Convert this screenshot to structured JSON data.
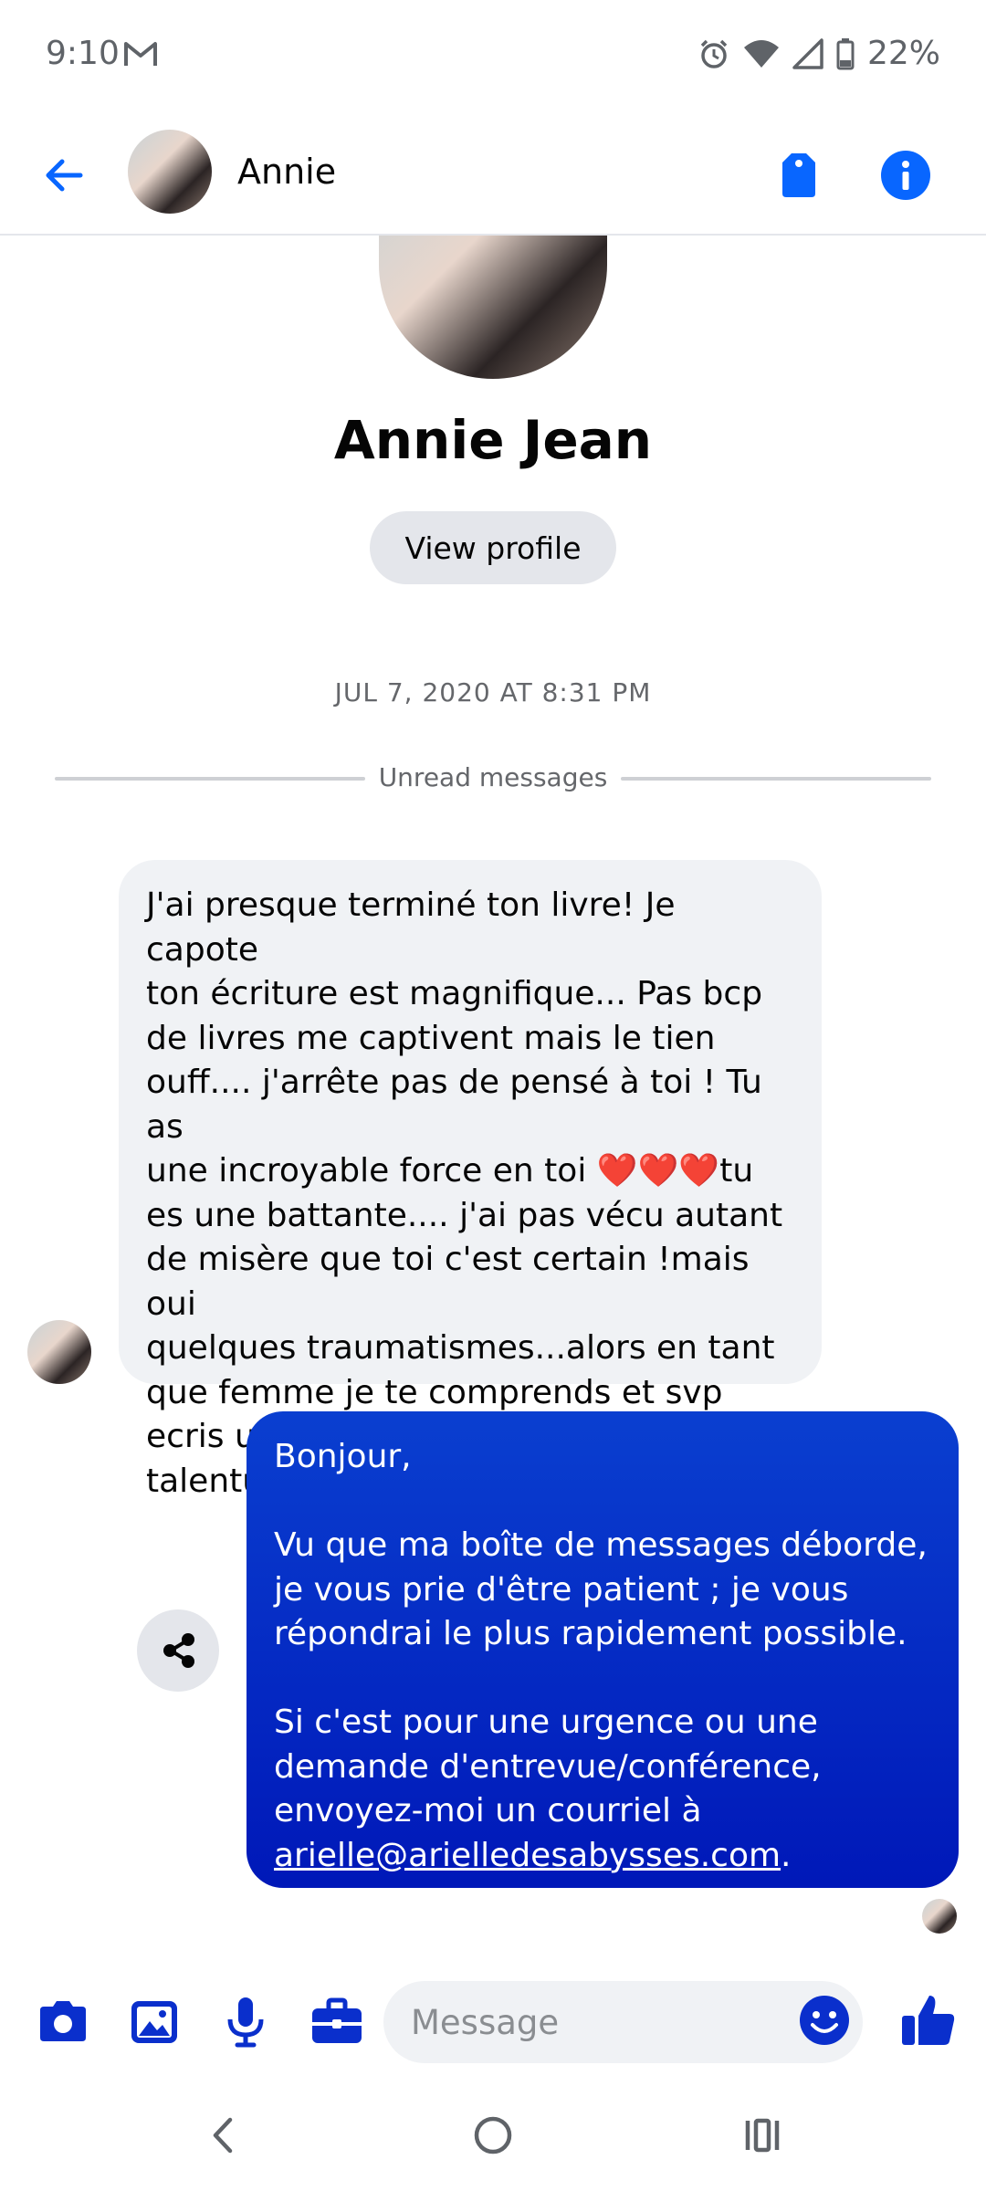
{
  "status_bar": {
    "time": "9:10",
    "battery": "22%",
    "icons": [
      "gmail-icon",
      "alarm-icon",
      "wifi-icon",
      "signal-icon",
      "battery-icon"
    ]
  },
  "header": {
    "contact_name": "Annie",
    "icons": [
      "back-arrow-icon",
      "tag-icon",
      "info-icon"
    ],
    "accent_color": "#0866ff"
  },
  "profile": {
    "full_name": "Annie Jean",
    "view_profile_label": "View profile"
  },
  "conversation": {
    "timestamp": "JUL 7, 2020 AT 8:31 PM",
    "unread_divider": "Unread messages",
    "messages": [
      {
        "direction": "incoming",
        "text": "J'ai presque terminé ton livre! Je capote\nton écriture est magnifique... Pas bcp\nde livres me captivent mais le tien\nouff.... j'arrête pas de pensé à toi ! Tu as\nune incroyable force en toi ❤️❤️❤️tu\nes une battante.... j'ai pas vécu autant\nde misère que toi c'est certain !mais oui\nquelques traumatismes...alors en tant\nque femme je te comprends et svp\necris un autre livre lolll tu es très\ntalentueuse et intelligente 😘"
      },
      {
        "direction": "outgoing",
        "text": "Bonjour,\n\nVu que ma boîte de messages déborde,\nje vous prie d'être patient ; je vous\nrépondrai le plus rapidement possible.\n\nSi c'est pour une urgence ou une\ndemande d'entrevue/conférence,\nenvoyez-moi un courriel à\n",
        "email": "arielle@arielledesabysses.com",
        "trailing": "."
      }
    ]
  },
  "composer": {
    "placeholder": "Message",
    "icons": [
      "camera-icon",
      "gallery-icon",
      "microphone-icon",
      "briefcase-icon",
      "emoji-icon",
      "thumbs-up-icon"
    ]
  },
  "colors": {
    "outgoing_bubble": "#0a2fcc",
    "incoming_bubble": "#f0f2f5",
    "composer_icons": "#0a2fcc"
  }
}
